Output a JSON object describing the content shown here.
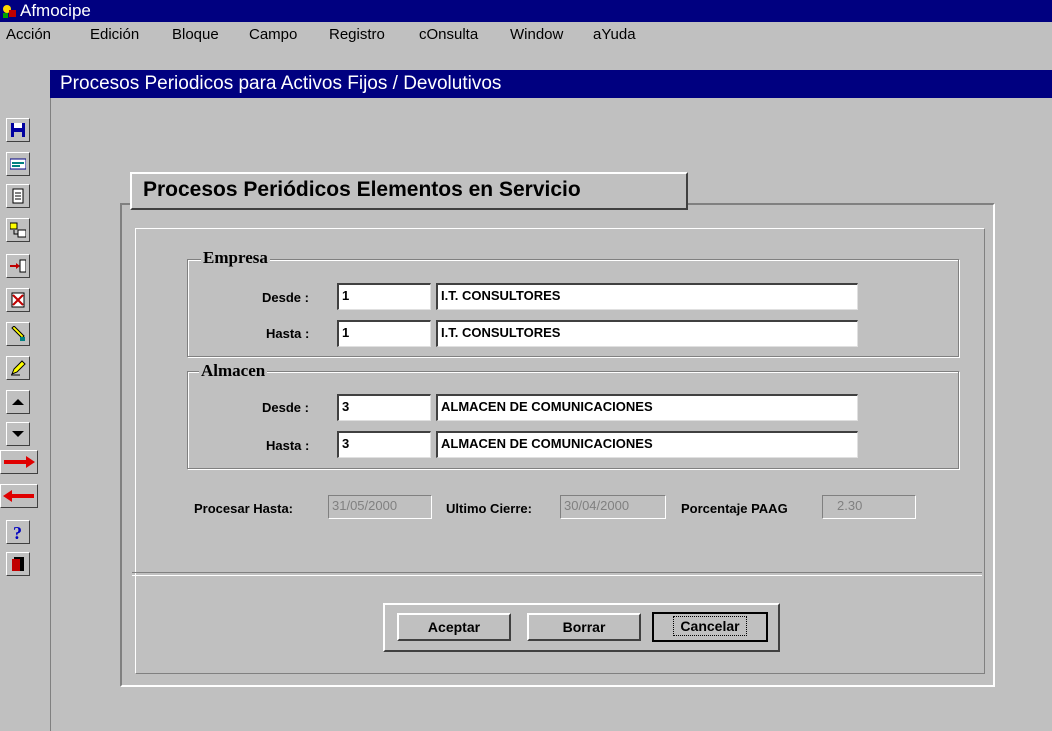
{
  "window": {
    "app_title": "Afmocipe",
    "form_title": "Procesos Periodicos para Activos Fijos / Devolutivos"
  },
  "menu": [
    "Acción",
    "Edición",
    "Bloque",
    "Campo",
    "Registro",
    "cOnsulta",
    "Window",
    "aYuda"
  ],
  "toolbar": {
    "icons": [
      "save-icon",
      "enter-query-icon",
      "execute-query-icon",
      "list-values-icon",
      "insert-record-icon",
      "delete-record-icon",
      "clear-icon",
      "edit-icon",
      "previous-record-icon",
      "next-record-icon",
      "next-block-icon",
      "previous-block-icon",
      "help-icon",
      "exit-icon"
    ]
  },
  "form": {
    "header": "Procesos Periódicos Elementos en Servicio",
    "empresa": {
      "label": "Empresa",
      "desde_label": "Desde :",
      "desde_code": "1",
      "desde_name": "I.T. CONSULTORES",
      "hasta_label": "Hasta :",
      "hasta_code": "1",
      "hasta_name": "I.T. CONSULTORES"
    },
    "almacen": {
      "label": "Almacen",
      "desde_label": "Desde :",
      "desde_code": "3",
      "desde_name": "ALMACEN DE COMUNICACIONES",
      "hasta_label": "Hasta :",
      "hasta_code": "3",
      "hasta_name": "ALMACEN DE COMUNICACIONES"
    },
    "procesar_hasta_label": "Procesar Hasta:",
    "procesar_hasta_value": "31/05/2000",
    "ultimo_cierre_label": "Ultimo Cierre:",
    "ultimo_cierre_value": "30/04/2000",
    "porcentaje_label": "Porcentaje PAAG",
    "porcentaje_value": "2.30"
  },
  "buttons": {
    "aceptar": "Aceptar",
    "borrar": "Borrar",
    "cancelar": "Cancelar"
  },
  "colors": {
    "titlebar": "#000080",
    "background": "#c0c0c0"
  }
}
